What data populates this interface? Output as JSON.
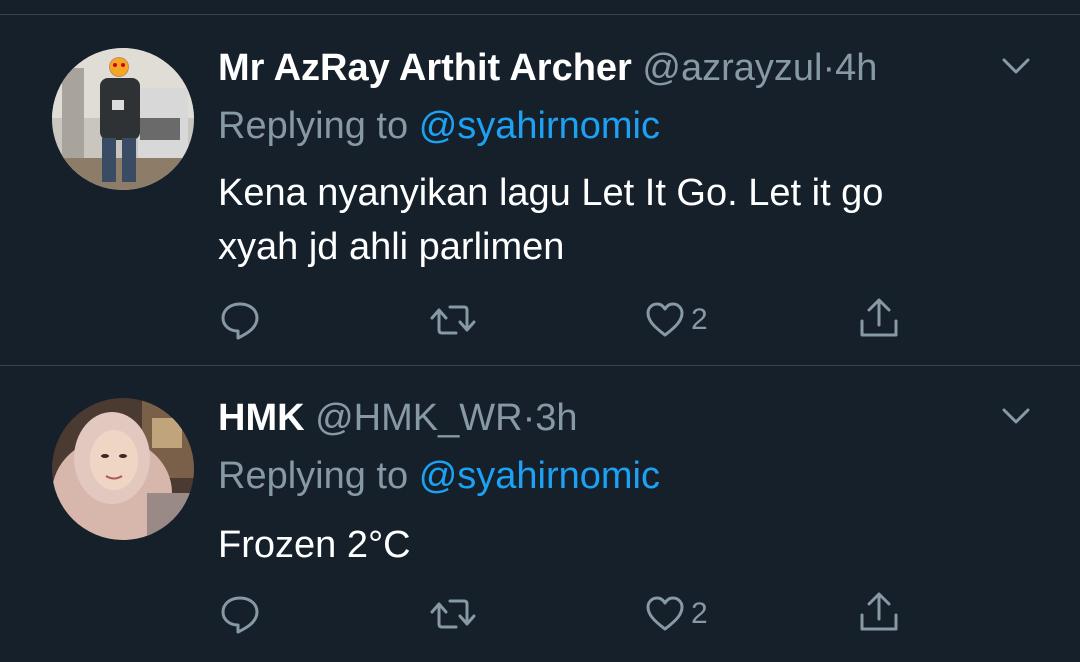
{
  "tweets": [
    {
      "name": "Mr AzRay Arthit Archer",
      "handle": "@azrayzul",
      "separator": "·",
      "time": "4h",
      "replying_prefix": "Replying to",
      "replying_to": "@syahirnomic",
      "text_line1": "Kena nyanyikan lagu Let It Go. Let it go",
      "text_line2": "xyah jd ahli parlimen",
      "like_count": "2",
      "icons": [
        "reply-icon",
        "retweet-icon",
        "like-icon",
        "share-icon",
        "chevron-down-icon"
      ]
    },
    {
      "name": "HMK",
      "handle": "@HMK_WR",
      "separator": "·",
      "time": "3h",
      "replying_prefix": "Replying to",
      "replying_to": "@syahirnomic",
      "text_line1": "Frozen 2°C",
      "like_count": "2",
      "icons": [
        "reply-icon",
        "retweet-icon",
        "like-icon",
        "share-icon",
        "chevron-down-icon"
      ]
    }
  ],
  "colors": {
    "background": "#15202b",
    "text": "#ffffff",
    "secondary": "#8899a6",
    "accent": "#1da1f2",
    "divider": "#38444d"
  }
}
